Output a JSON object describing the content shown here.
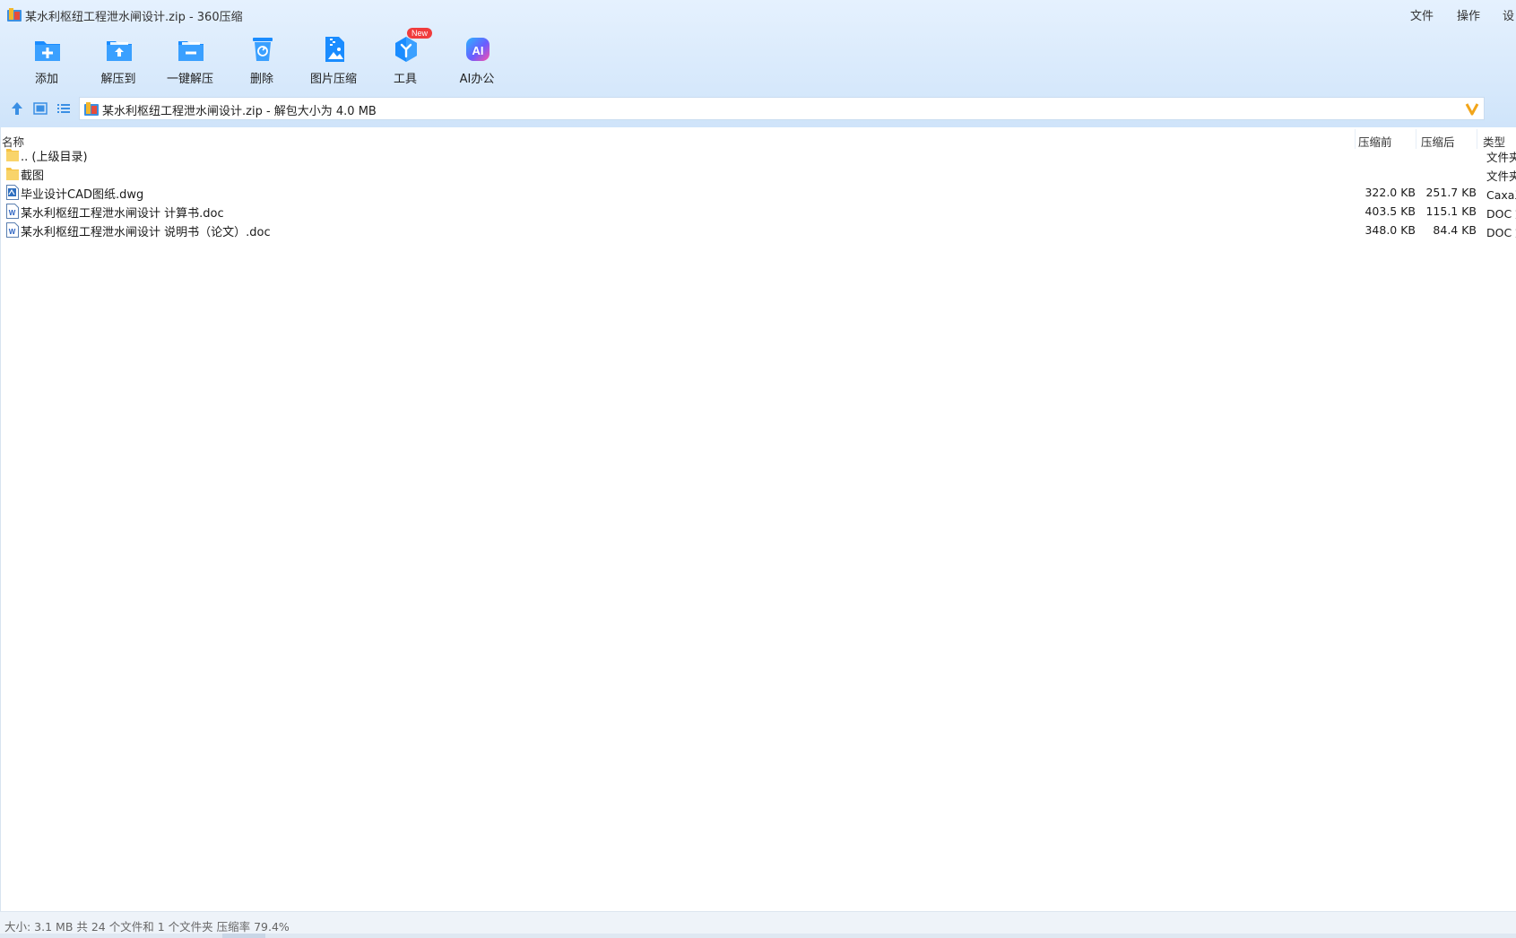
{
  "window": {
    "title": "某水利枢纽工程泄水闸设计.zip - 360压缩",
    "menu": [
      "文件",
      "操作",
      "设"
    ]
  },
  "toolbar": {
    "buttons": [
      {
        "label": "添加",
        "icon": "add-icon"
      },
      {
        "label": "解压到",
        "icon": "extract-to-icon"
      },
      {
        "label": "一键解压",
        "icon": "one-click-extract-icon"
      },
      {
        "label": "删除",
        "icon": "delete-icon"
      },
      {
        "label": "图片压缩",
        "icon": "image-compress-icon"
      },
      {
        "label": "工具",
        "icon": "tools-icon"
      },
      {
        "label": "AI办公",
        "icon": "ai-office-icon"
      }
    ],
    "new_badge": "New"
  },
  "address": {
    "path": "某水利枢纽工程泄水闸设计.zip - 解包大小为 4.0 MB"
  },
  "file_list": {
    "columns": {
      "name": "名称",
      "original": "压缩前",
      "compressed": "压缩后",
      "type": "类型"
    },
    "rows": [
      {
        "name": ".. (上级目录)",
        "original": "",
        "compressed": "",
        "type": "文件夹",
        "icon": "folder-icon"
      },
      {
        "name": "截图",
        "original": "",
        "compressed": "",
        "type": "文件夹",
        "icon": "folder-icon"
      },
      {
        "name": "毕业设计CAD图纸.dwg",
        "original": "322.0 KB",
        "compressed": "251.7 KB",
        "type": "Caxa工",
        "icon": "dwg-file-icon"
      },
      {
        "name": "某水利枢纽工程泄水闸设计 计算书.doc",
        "original": "403.5 KB",
        "compressed": "115.1 KB",
        "type": "DOC 文",
        "icon": "word-file-icon"
      },
      {
        "name": "某水利枢纽工程泄水闸设计 说明书（论文）.doc",
        "original": "348.0 KB",
        "compressed": "84.4 KB",
        "type": "DOC 文",
        "icon": "word-file-icon"
      }
    ]
  },
  "status": {
    "text": "大小: 3.1 MB 共 24 个文件和 1 个文件夹 压缩率 79.4%"
  },
  "colors": {
    "accent_blue": "#1a8cff",
    "header_bg": "#d6e8fb",
    "folder_yellow": "#f6c343",
    "badge_red": "#f03c3c"
  }
}
